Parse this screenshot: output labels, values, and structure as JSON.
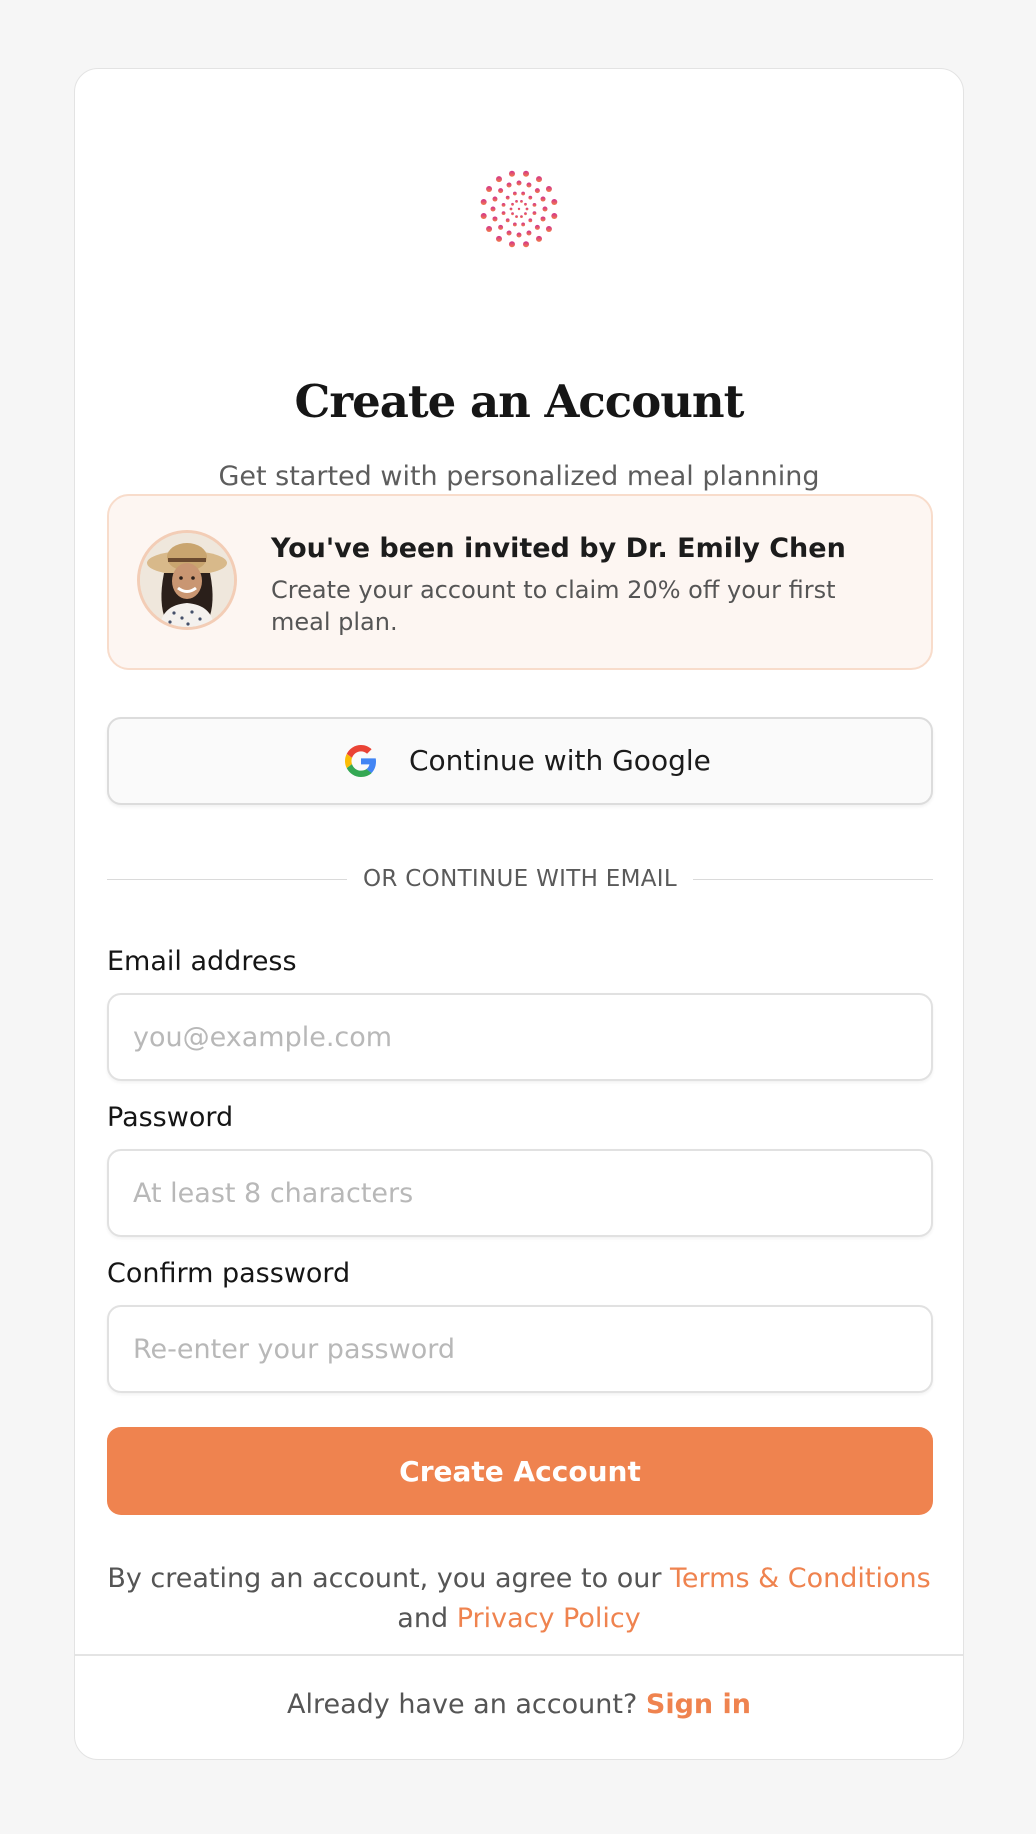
{
  "header": {
    "title": "Create an Account",
    "subtitle": "Get started with personalized meal planning"
  },
  "invite": {
    "title": "You've been invited by Dr. Emily Chen",
    "text": "Create your account to claim 20% off your first meal plan.",
    "avatar_icon": "person-avatar"
  },
  "google": {
    "label": "Continue with Google",
    "icon": "google-icon"
  },
  "divider": {
    "text": "OR CONTINUE WITH EMAIL"
  },
  "form": {
    "email": {
      "label": "Email address",
      "placeholder": "you@example.com"
    },
    "password": {
      "label": "Password",
      "placeholder": "At least 8 characters"
    },
    "confirm": {
      "label": "Confirm password",
      "placeholder": "Re-enter your password"
    },
    "submit_label": "Create Account"
  },
  "terms": {
    "prefix": "By creating an account, you agree to our ",
    "terms_link": "Terms & Conditions",
    "middle": " and ",
    "privacy_link": "Privacy Policy"
  },
  "footer": {
    "prefix": "Already have an account? ",
    "signin_link": "Sign in"
  },
  "colors": {
    "accent": "#ef834f",
    "logo_top": "#d2318f",
    "logo_bottom": "#f27b4a",
    "invite_bg": "#fdf6f2"
  }
}
